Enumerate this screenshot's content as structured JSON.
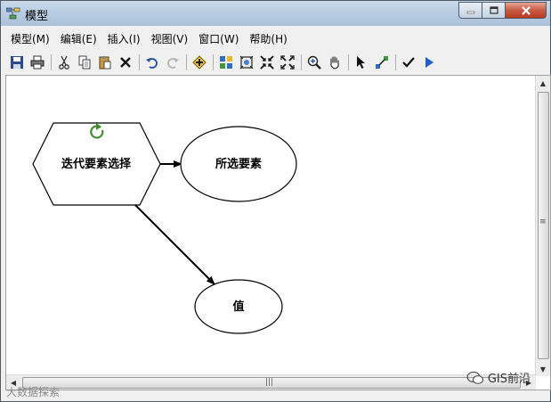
{
  "window": {
    "title": "模型"
  },
  "menu": [
    {
      "label": "模型(M)"
    },
    {
      "label": "编辑(E)"
    },
    {
      "label": "插入(I)"
    },
    {
      "label": "视图(V)"
    },
    {
      "label": "窗口(W)"
    },
    {
      "label": "帮助(H)"
    }
  ],
  "toolbar": [
    "save-icon",
    "print-icon",
    "cut-icon",
    "copy-icon",
    "paste-icon",
    "delete-icon",
    "undo-icon",
    "redo-icon",
    "add-data-icon",
    "auto-layout-icon",
    "full-extent-icon",
    "zoom-in-fixed-icon",
    "zoom-out-fixed-icon",
    "zoom-in-icon",
    "pan-icon",
    "select-icon",
    "connect-icon",
    "validate-icon",
    "run-icon"
  ],
  "diagram": {
    "nodes": [
      {
        "id": "iterator",
        "label": "迭代要素选择",
        "shape": "hexagon",
        "iterator_icon": "refresh-icon"
      },
      {
        "id": "selected",
        "label": "所选要素",
        "shape": "ellipse"
      },
      {
        "id": "value",
        "label": "值",
        "shape": "ellipse"
      }
    ],
    "edges": [
      {
        "from": "iterator",
        "to": "selected"
      },
      {
        "from": "iterator",
        "to": "value"
      }
    ]
  },
  "watermark": {
    "text": "GIS前沿",
    "corner_text": "大数据探索"
  },
  "colors": {
    "iterator_icon": "#3f8f2f",
    "titlebar": "#b8cde2"
  }
}
